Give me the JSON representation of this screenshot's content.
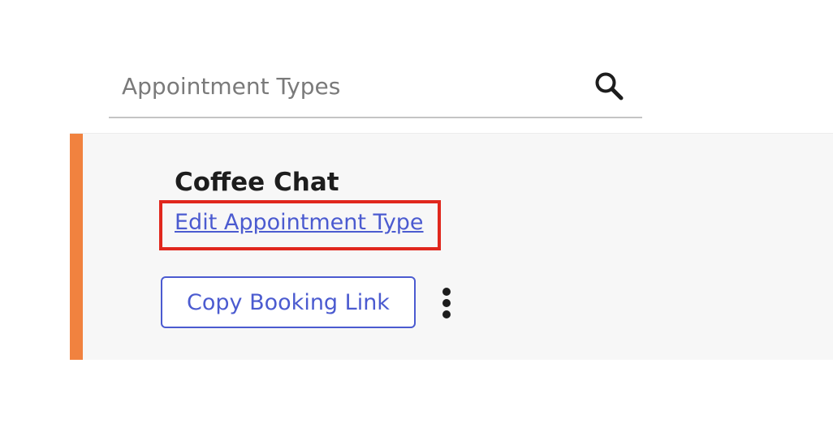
{
  "search": {
    "placeholder": "Appointment Types",
    "icon": "search-icon"
  },
  "card": {
    "accent_color": "#f1823f",
    "title": "Coffee Chat",
    "edit_link_label": "Edit Appointment Type",
    "copy_button_label": "Copy Booking Link",
    "more_icon": "more-vertical-icon",
    "highlight_color": "#e0271d",
    "link_color": "#4b5bd0"
  }
}
